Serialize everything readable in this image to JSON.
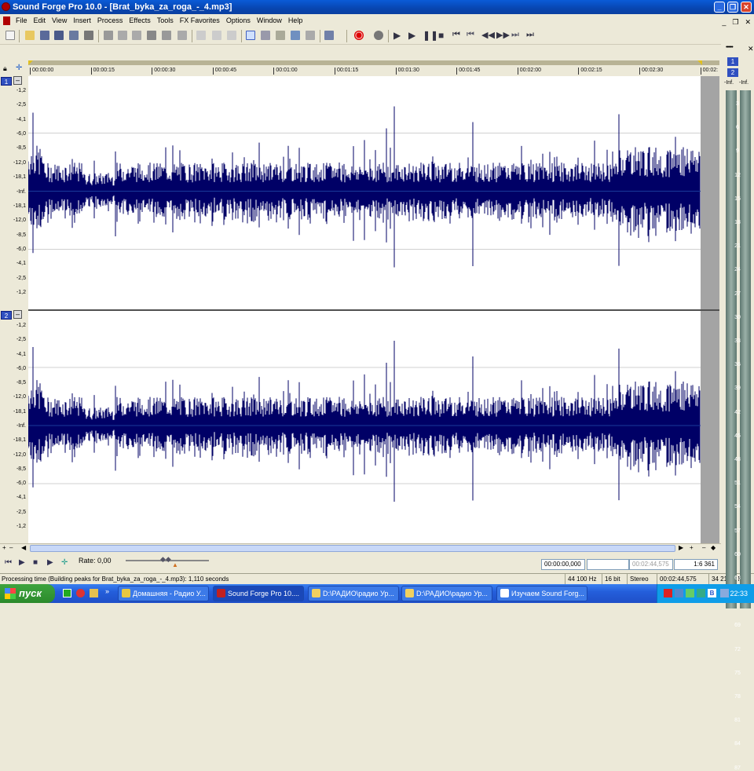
{
  "window": {
    "title": "Sound Forge Pro 10.0 - [Brat_byka_za_roga_-_4.mp3]"
  },
  "menu": [
    "File",
    "Edit",
    "View",
    "Insert",
    "Process",
    "Effects",
    "Tools",
    "FX Favorites",
    "Options",
    "Window",
    "Help"
  ],
  "ruler": {
    "ticks": [
      "00:00:00",
      "00:00:15",
      "00:00:30",
      "00:00:45",
      "00:01:00",
      "00:01:15",
      "00:01:30",
      "00:01:45",
      "00:02:00",
      "00:02:15",
      "00:02:30",
      "00:02:"
    ]
  },
  "tracks": [
    {
      "number": "1",
      "labels": [
        "-1,2",
        "-2,5",
        "-4,1",
        "-6,0",
        "-8,5",
        "-12,0",
        "-18,1",
        "-Inf.",
        "-18,1",
        "-12,0",
        "-8,5",
        "-6,0",
        "-4,1",
        "-2,5",
        "-1,2"
      ]
    },
    {
      "number": "2",
      "labels": [
        "-1,2",
        "-2,5",
        "-4,1",
        "-6,0",
        "-8,5",
        "-12,0",
        "-18,1",
        "-Inf.",
        "-18,1",
        "-12,0",
        "-8,5",
        "-6,0",
        "-4,1",
        "-2,5",
        "-1,2"
      ]
    }
  ],
  "transport": {
    "rate_label": "Rate: 0,00",
    "time_cursor": "00:00:00,000",
    "time_length": "00:02:44,575",
    "zoom": "1:6 361"
  },
  "status": {
    "message": "Processing time (Building peaks for Brat_byka_za_roga_-_4.mp3): 1,110 seconds",
    "sample_rate": "44 100 Hz",
    "bit_depth": "16 bit",
    "channels": "Stereo",
    "length": "00:02:44,575",
    "disk": "34 213,2 MB"
  },
  "meters": {
    "channel_buttons": [
      "1",
      "2"
    ],
    "headers": [
      "-Inf.",
      "-Inf."
    ],
    "scale": [
      "3",
      "6",
      "9",
      "12",
      "15",
      "18",
      "21",
      "24",
      "27",
      "30",
      "33",
      "36",
      "39",
      "42",
      "45",
      "48",
      "51",
      "54",
      "57",
      "60",
      "63",
      "66",
      "69",
      "72",
      "75",
      "78",
      "81",
      "84",
      "87"
    ]
  },
  "taskbar": {
    "start_label": "пуск",
    "items": [
      {
        "label": "Домашняя - Радио У...",
        "active": false
      },
      {
        "label": "Sound Forge Pro 10....",
        "active": true
      },
      {
        "label": "D:\\РАДИО\\радио Ур...",
        "active": false
      },
      {
        "label": "D:\\РАДИО\\радио Ур...",
        "active": false
      },
      {
        "label": "Изучаем Sound Forg...",
        "active": false
      }
    ],
    "clock": "22:33"
  },
  "colors": {
    "waveform": "#000066",
    "title_bar": "#0a5bd8",
    "track_badge": "#3050c0"
  }
}
